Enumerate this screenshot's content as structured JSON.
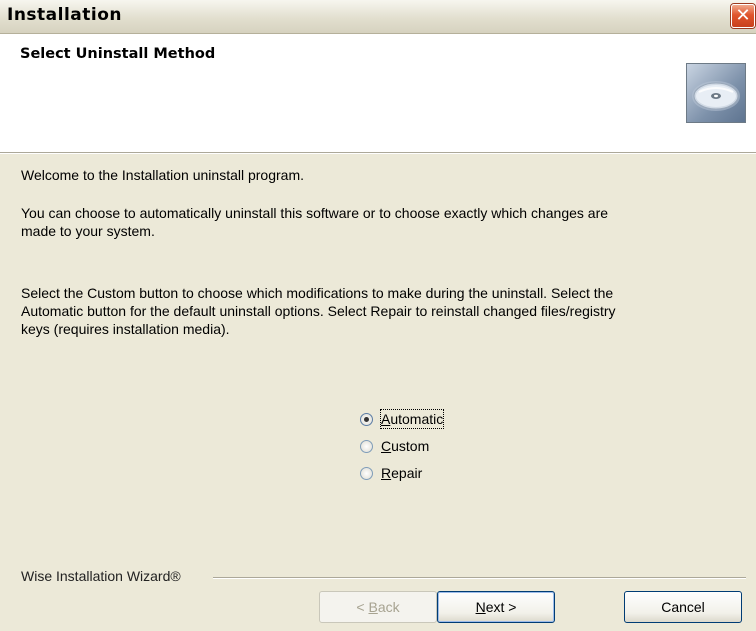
{
  "window": {
    "title": "Installation",
    "close_glyph": "✕"
  },
  "header": {
    "title": "Select Uninstall Method",
    "icon": "cd-disc-icon"
  },
  "body": {
    "paragraph1": "Welcome to the  Installation uninstall program.",
    "paragraph2_line1": "You can choose to automatically uninstall this software or to choose exactly which changes are",
    "paragraph2_line2": "made to your system.",
    "paragraph3_line1": "Select the Custom button to choose which modifications to make during the uninstall. Select the",
    "paragraph3_line2": "Automatic button for the default uninstall options. Select Repair to reinstall changed files/registry",
    "paragraph3_line3": "keys (requires installation media)."
  },
  "options": [
    {
      "mnemonic": "A",
      "rest": "utomatic",
      "selected": true
    },
    {
      "mnemonic": "C",
      "rest": "ustom",
      "selected": false
    },
    {
      "mnemonic": "R",
      "rest": "epair",
      "selected": false
    }
  ],
  "footer": {
    "brand": "Wise Installation Wizard®",
    "back_prefix": "< ",
    "back_mnemonic": "B",
    "back_rest": "ack",
    "next_mnemonic": "N",
    "next_rest": "ext >",
    "cancel_label": "Cancel"
  },
  "colors": {
    "dialog_bg": "#ece9d8",
    "close_red": "#e0552d",
    "button_border": "#003c74"
  }
}
